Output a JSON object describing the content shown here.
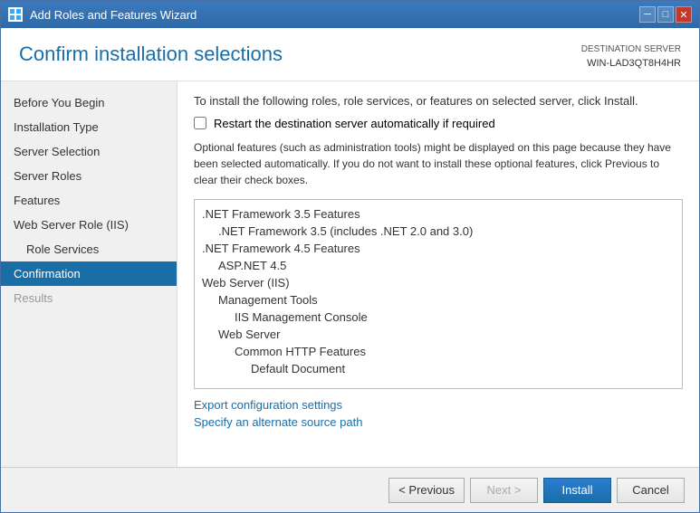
{
  "window": {
    "title": "Add Roles and Features Wizard",
    "controls": {
      "minimize": "─",
      "maximize": "□",
      "close": "✕"
    }
  },
  "header": {
    "page_title": "Confirm installation selections",
    "destination_server_label": "DESTINATION SERVER",
    "destination_server_value": "WIN-LAD3QT8H4HR"
  },
  "sidebar": {
    "items": [
      {
        "label": "Before You Begin",
        "level": "normal",
        "state": "normal"
      },
      {
        "label": "Installation Type",
        "level": "normal",
        "state": "normal"
      },
      {
        "label": "Server Selection",
        "level": "normal",
        "state": "normal"
      },
      {
        "label": "Server Roles",
        "level": "normal",
        "state": "normal"
      },
      {
        "label": "Features",
        "level": "normal",
        "state": "normal"
      },
      {
        "label": "Web Server Role (IIS)",
        "level": "normal",
        "state": "normal"
      },
      {
        "label": "Role Services",
        "level": "sub",
        "state": "normal"
      },
      {
        "label": "Confirmation",
        "level": "normal",
        "state": "active"
      },
      {
        "label": "Results",
        "level": "normal",
        "state": "disabled"
      }
    ]
  },
  "content": {
    "intro_text": "To install the following roles, role services, or features on selected server, click Install.",
    "checkbox_label": "Restart the destination server automatically if required",
    "note_text": "Optional features (such as administration tools) might be displayed on this page because they have been selected automatically. If you do not want to install these optional features, click Previous to clear their check boxes.",
    "features": [
      {
        "label": ".NET Framework 3.5 Features",
        "level": "l1"
      },
      {
        "label": ".NET Framework 3.5 (includes .NET 2.0 and 3.0)",
        "level": "l2"
      },
      {
        "label": ".NET Framework 4.5 Features",
        "level": "l1"
      },
      {
        "label": "ASP.NET 4.5",
        "level": "l2"
      },
      {
        "label": "Web Server (IIS)",
        "level": "l1"
      },
      {
        "label": "Management Tools",
        "level": "l2"
      },
      {
        "label": "IIS Management Console",
        "level": "l3"
      },
      {
        "label": "Web Server",
        "level": "l2"
      },
      {
        "label": "Common HTTP Features",
        "level": "l3"
      },
      {
        "label": "Default Document",
        "level": "l4"
      }
    ],
    "links": [
      {
        "label": "Export configuration settings"
      },
      {
        "label": "Specify an alternate source path"
      }
    ]
  },
  "footer": {
    "previous_label": "< Previous",
    "next_label": "Next >",
    "install_label": "Install",
    "cancel_label": "Cancel"
  }
}
